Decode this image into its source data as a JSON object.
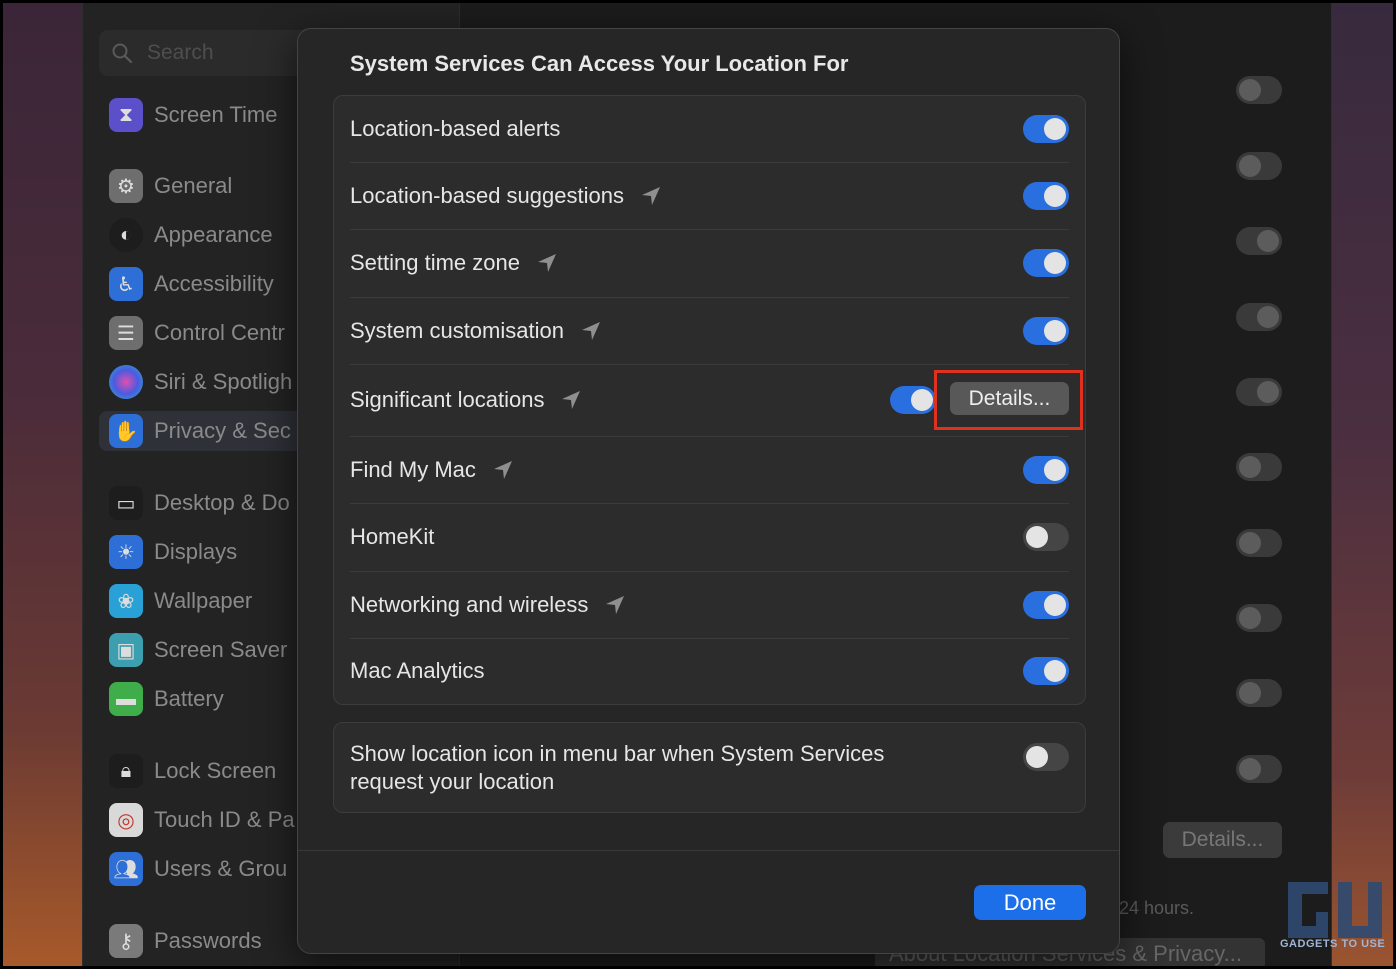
{
  "search": {
    "placeholder": "Search"
  },
  "sidebar": {
    "items": [
      {
        "label": "Screen Time",
        "icon": "hourglass-icon",
        "color": "#5b50c9"
      },
      {
        "label": "General",
        "icon": "gear-icon",
        "color": "#6e6e6e"
      },
      {
        "label": "Appearance",
        "icon": "appearance-icon",
        "color": "#1d1d1d"
      },
      {
        "label": "Accessibility",
        "icon": "accessibility-icon",
        "color": "#2d6fd6"
      },
      {
        "label": "Control Centr",
        "icon": "control-centre-icon",
        "color": "#6e6e6e"
      },
      {
        "label": "Siri & Spotligh",
        "icon": "siri-icon",
        "color": "#8a3fb8"
      },
      {
        "label": "Privacy & Sec",
        "icon": "hand-icon",
        "color": "#2d6fd6"
      },
      {
        "label": "Desktop & Do",
        "icon": "desktop-icon",
        "color": "#1d1d1d"
      },
      {
        "label": "Displays",
        "icon": "sun-icon",
        "color": "#2d6fd6"
      },
      {
        "label": "Wallpaper",
        "icon": "flower-icon",
        "color": "#2aa1d6"
      },
      {
        "label": "Screen Saver",
        "icon": "screen-saver-icon",
        "color": "#3b9fb0"
      },
      {
        "label": "Battery",
        "icon": "battery-icon",
        "color": "#3fae4a"
      },
      {
        "label": "Lock Screen",
        "icon": "lock-icon",
        "color": "#1d1d1d"
      },
      {
        "label": "Touch ID & Pa",
        "icon": "fingerprint-icon",
        "color": "#d9d9d9"
      },
      {
        "label": "Users & Grou",
        "icon": "users-icon",
        "color": "#2d6fd6"
      },
      {
        "label": "Passwords",
        "icon": "key-icon",
        "color": "#7a7a7a"
      }
    ]
  },
  "background": {
    "details_label": "Details...",
    "hours_text": "24 hours.",
    "about_label": "About Location Services & Privacy..."
  },
  "sheet": {
    "title": "System Services Can Access Your Location For",
    "services": [
      {
        "label": "Location-based alerts",
        "arrow": false,
        "on": true
      },
      {
        "label": "Location-based suggestions",
        "arrow": true,
        "on": true
      },
      {
        "label": "Setting time zone",
        "arrow": true,
        "on": true
      },
      {
        "label": "System customisation",
        "arrow": true,
        "on": true
      },
      {
        "label": "Significant locations",
        "arrow": true,
        "on": true,
        "details_label": "Details..."
      },
      {
        "label": "Find My Mac",
        "arrow": true,
        "on": true
      },
      {
        "label": "HomeKit",
        "arrow": false,
        "on": false
      },
      {
        "label": "Networking and wireless",
        "arrow": true,
        "on": true
      },
      {
        "label": "Mac Analytics",
        "arrow": false,
        "on": true
      }
    ],
    "menu_bar_option": {
      "label_line1": "Show location icon in menu bar when System Services",
      "label_line2": "request your location",
      "on": false
    },
    "done_label": "Done"
  },
  "watermark": {
    "text": "GADGETS TO USE"
  },
  "colors": {
    "accent": "#2a6fe0",
    "highlight": "#e0301e",
    "done": "#1c6fe8"
  }
}
